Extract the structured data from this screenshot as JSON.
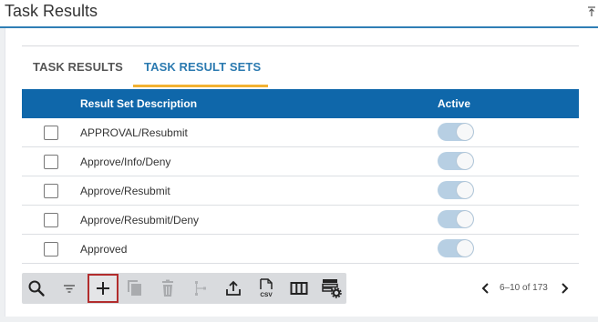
{
  "window": {
    "title": "Task Results"
  },
  "tabs": [
    {
      "label": "TASK RESULTS",
      "active": false
    },
    {
      "label": "TASK RESULT SETS",
      "active": true
    }
  ],
  "table": {
    "columns": [
      "Result Set Description",
      "Active"
    ],
    "rows": [
      {
        "description": "APPROVAL/Resubmit",
        "active": true
      },
      {
        "description": "Approve/Info/Deny",
        "active": true
      },
      {
        "description": "Approve/Resubmit",
        "active": true
      },
      {
        "description": "Approve/Resubmit/Deny",
        "active": true
      },
      {
        "description": "Approved",
        "active": true
      }
    ]
  },
  "toolbar": {
    "buttons": [
      "search-icon",
      "filter-icon",
      "add-icon",
      "copy-icon",
      "delete-icon",
      "hierarchy-icon",
      "export-icon",
      "csv-icon",
      "columns-icon",
      "grid-settings-icon"
    ],
    "csv_label": "CSV"
  },
  "pagination": {
    "text": "6–10 of 173"
  },
  "colors": {
    "header_bg": "#0f67aa",
    "active_tab": "#2b7ab0",
    "tab_underline": "#f2b233",
    "toggle_on": "#b7cfe3",
    "highlight": "#b22d2d"
  }
}
